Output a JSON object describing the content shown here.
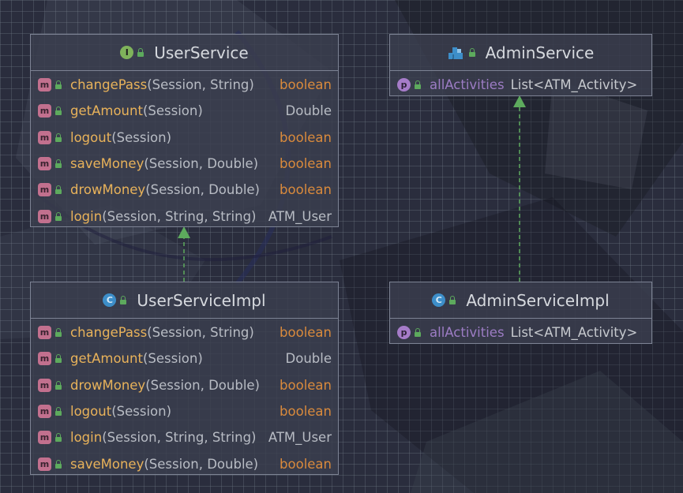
{
  "background_color": "#2a2d3d",
  "nodes": {
    "user_service": {
      "kind_icon": "interface-icon",
      "badge_letter": "I",
      "title": "UserService",
      "methods": [
        {
          "name": "changePass",
          "params": "(Session, String)",
          "return_type": "boolean"
        },
        {
          "name": "getAmount",
          "params": "(Session)",
          "return_type": "Double"
        },
        {
          "name": "logout",
          "params": "(Session)",
          "return_type": "boolean"
        },
        {
          "name": "saveMoney",
          "params": "(Session, Double)",
          "return_type": "boolean"
        },
        {
          "name": "drowMoney",
          "params": "(Session, Double)",
          "return_type": "boolean"
        },
        {
          "name": "login",
          "params": "(Session, String, String)",
          "return_type": "ATM_User"
        }
      ]
    },
    "admin_service": {
      "kind_icon": "package-class-icon",
      "title": "AdminService",
      "fields": [
        {
          "badge_letter": "p",
          "name": "allActivities",
          "type": "List<ATM_Activity>"
        }
      ]
    },
    "user_service_impl": {
      "kind_icon": "class-icon",
      "badge_letter": "C",
      "title": "UserServiceImpl",
      "methods": [
        {
          "name": "changePass",
          "params": "(Session, String)",
          "return_type": "boolean"
        },
        {
          "name": "getAmount",
          "params": "(Session)",
          "return_type": "Double"
        },
        {
          "name": "drowMoney",
          "params": "(Session, Double)",
          "return_type": "boolean"
        },
        {
          "name": "logout",
          "params": "(Session)",
          "return_type": "boolean"
        },
        {
          "name": "login",
          "params": "(Session, String, String)",
          "return_type": "ATM_User"
        },
        {
          "name": "saveMoney",
          "params": "(Session, Double)",
          "return_type": "boolean"
        }
      ]
    },
    "admin_service_impl": {
      "kind_icon": "class-icon",
      "badge_letter": "C",
      "title": "AdminServiceImpl",
      "fields": [
        {
          "badge_letter": "p",
          "name": "allActivities",
          "type": "List<ATM_Activity>"
        }
      ]
    }
  },
  "method_badge_letter": "m",
  "colors": {
    "method_name": "#e8b25a",
    "boolean_type": "#d98a3c",
    "plain_type": "#b8bcc4",
    "field_name": "#9c7cc4",
    "arrow": "#5daa5d",
    "border": "#7d8394"
  },
  "edges": [
    {
      "from": "UserServiceImpl",
      "to": "UserService",
      "style": "dashed",
      "kind": "implements"
    },
    {
      "from": "AdminServiceImpl",
      "to": "AdminService",
      "style": "dashed",
      "kind": "implements"
    }
  ]
}
